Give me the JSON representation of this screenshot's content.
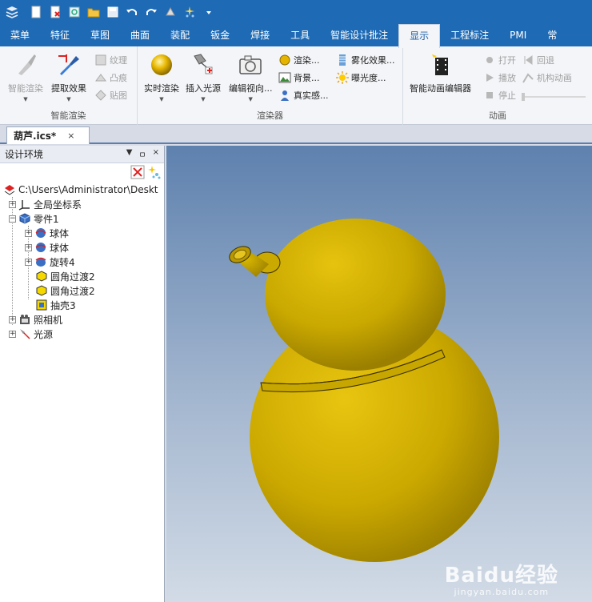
{
  "ribbon_tabs": [
    "菜单",
    "特征",
    "草图",
    "曲面",
    "装配",
    "钣金",
    "焊接",
    "工具",
    "智能设计批注",
    "显示",
    "工程标注",
    "PMI",
    "常"
  ],
  "active_tab": "显示",
  "groups": {
    "smart_render": {
      "label": "智能渲染",
      "btn_smart_render": "智能渲染",
      "btn_extract_effect": "提取效果",
      "btn_texture": "纹理",
      "btn_bump": "凸痕",
      "btn_decal": "贴图"
    },
    "renderer": {
      "label": "渲染器",
      "btn_realtime_render": "实时渲染",
      "btn_insert_light": "插入光源",
      "btn_edit_view": "编辑视向...",
      "btn_render": "渲染...",
      "btn_background": "背景...",
      "btn_realism": "真实感...",
      "btn_fog": "雾化效果...",
      "btn_exposure": "曝光度..."
    },
    "animation": {
      "label": "动画",
      "btn_anim_editor": "智能动画编辑器",
      "btn_open": "打开",
      "btn_rewind": "回退",
      "btn_play": "播放",
      "btn_mech_anim": "机构动画",
      "btn_stop": "停止"
    }
  },
  "document_tab": {
    "title": "葫芦.ics*",
    "close": "×"
  },
  "panel": {
    "title": "设计环境",
    "controls": [
      "▼",
      "ㅁ",
      "×"
    ],
    "tree": {
      "root": "C:\\Users\\Administrator\\Deskt",
      "global_coord": "全局坐标系",
      "part": "零件1",
      "features": [
        "球体",
        "球体",
        "旋转4",
        "圆角过渡2",
        "圆角过渡2",
        "抽壳3"
      ],
      "camera": "照相机",
      "light": "光源"
    }
  },
  "watermark": {
    "brand": "Baidu经验",
    "url": "jingyan.baidu.com"
  },
  "colors": {
    "title_blue": "#1e6ab4",
    "model_yellow": "#c9a800",
    "viewport_top": "#5e81ae",
    "viewport_bottom": "#d2dbe6"
  }
}
